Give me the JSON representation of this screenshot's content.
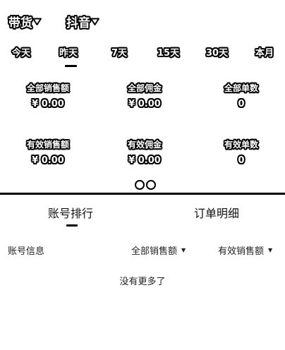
{
  "header": {
    "mode_label": "带货",
    "platform_label": "抖音",
    "dropdown_icon": "triangle-down-icon"
  },
  "periods": [
    "今天",
    "昨天",
    "7天",
    "15天",
    "30天",
    "本月"
  ],
  "selected_period": "昨天",
  "metrics": {
    "row1": [
      {
        "label": "全部销售额",
        "value": "¥ 0.00"
      },
      {
        "label": "全部佣金",
        "value": "¥ 0.00"
      },
      {
        "label": "全部单数",
        "value": "0"
      }
    ],
    "row2": [
      {
        "label": "有效销售额",
        "value": "¥ 0.00"
      },
      {
        "label": "有效佣金",
        "value": "¥ 0.00"
      },
      {
        "label": "有效单数",
        "value": "0"
      }
    ]
  },
  "tabs": [
    "账号排行",
    "订单明细"
  ],
  "active_tab": "账号排行",
  "list_header": {
    "account_info": "账号信息",
    "total_sales": "全部销售额",
    "valid_sales": "有效销售额",
    "sort_icon": "caret-down-icon"
  },
  "empty_text": "没有更多了"
}
